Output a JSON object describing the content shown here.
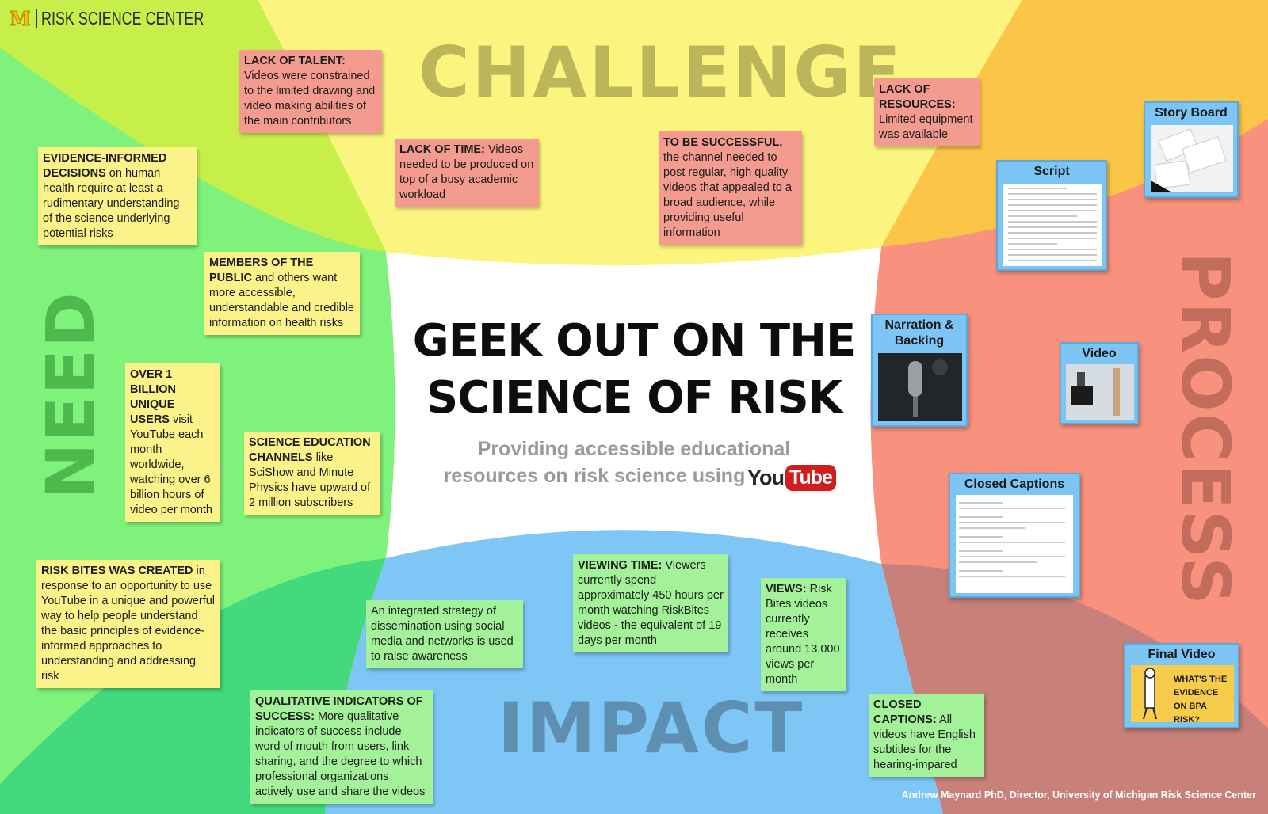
{
  "header": {
    "logo_mark": "M",
    "logo_text": "RISK SCIENCE CENTER"
  },
  "quadrants": {
    "challenge": "CHALLENGE",
    "need": "NEED",
    "impact": "IMPACT",
    "process": "PROCESS"
  },
  "center": {
    "title_line1": "GEEK OUT ON THE",
    "title_line2": "SCIENCE OF RISK",
    "subtitle_line1": "Providing accessible educational",
    "subtitle_line2": "resources on risk science using",
    "youtube_you": "You",
    "youtube_tube": "Tube"
  },
  "challenge_notes": {
    "talent_bold": "LACK OF TALENT:",
    "talent_text": " Videos were constrained to the limited drawing and video making abilities of the main contributors",
    "time_bold": "LACK OF TIME:",
    "time_text": " Videos needed to be produced on top of a busy academic workload",
    "success_bold": "TO BE SUCCESSFUL,",
    "success_text": " the channel needed to post regular, high quality videos that appealed to a broad audience, while providing useful information",
    "resources_bold": "LACK OF RESOURCES:",
    "resources_text": " Limited equipment was available"
  },
  "need_notes": {
    "evidence_bold": "EVIDENCE-INFORMED DECISIONS",
    "evidence_text": " on human health require at least a rudimentary understanding of the science underlying potential risks",
    "public_bold": "MEMBERS OF THE PUBLIC",
    "public_text": " and others want more accessible, understandable and credible information on health risks",
    "billion_bold": "OVER 1 BILLION UNIQUE USERS",
    "billion_text": " visit YouTube each month worldwide, watching over 6 billion hours of video per month",
    "science_bold": "SCIENCE EDUCATION CHANNELS",
    "science_text": " like SciShow and Minute Physics have upward of 2 million subscribers",
    "riskbites_bold": "RISK BITES WAS CREATED",
    "riskbites_text": " in response to an opportunity to use YouTube in a unique and powerful way to help people understand the basic principles of evidence-informed approaches to understanding and addressing risk"
  },
  "impact_notes": {
    "integrated_text": "An integrated strategy of dissemination using social media and networks is used to raise awareness",
    "viewing_bold": "VIEWING TIME:",
    "viewing_text": " Viewers currently spend approximately 450 hours per month watching RiskBites videos - the equivalent of 19 days per month",
    "views_bold": "VIEWS:",
    "views_text": " Risk Bites videos currently receives around 13,000 views per month",
    "qualitative_bold": "QUALITATIVE INDICATORS OF SUCCESS:",
    "qualitative_text": " More qualitative indicators of success include word of mouth from users, link sharing, and the degree to which professional organizations actively use and share the videos",
    "captions_bold": "CLOSED CAPTIONS:",
    "captions_text": " All videos have English subtitles for the hearing-impared"
  },
  "process_cards": {
    "story_board": "Story Board",
    "script": "Script",
    "narration": "Narration & Backing",
    "video": "Video",
    "closed_captions": "Closed Captions",
    "final_video": "Final Video",
    "final_video_poster": "WHAT'S THE EVIDENCE ON BPA RISK?"
  },
  "footer": {
    "credit": "Andrew Maynard PhD, Director, University of Michigan Risk Science Center"
  },
  "colors": {
    "challenge": "#fbf57f",
    "need": "#7ef27a",
    "impact": "#7ec6f6",
    "process": "#f8927e",
    "left_top": "#c6ef4a",
    "right_top": "#fbc648",
    "left_bottom": "#43d97c",
    "right_bottom": "#c7807a"
  }
}
